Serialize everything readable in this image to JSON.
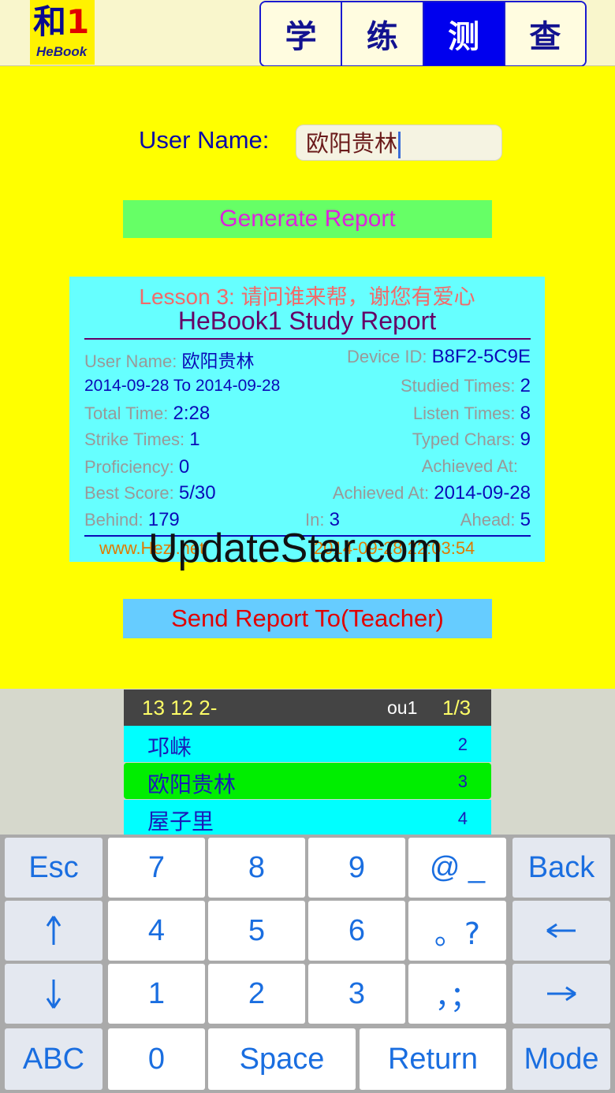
{
  "logo": {
    "glyph": "和",
    "digit": "1",
    "name": "HeBook"
  },
  "tabs": [
    {
      "label": "学",
      "active": false
    },
    {
      "label": "练",
      "active": false
    },
    {
      "label": "测",
      "active": true
    },
    {
      "label": "查",
      "active": false
    }
  ],
  "form": {
    "user_label": "User Name:",
    "user_value": "欧阳贵林",
    "generate_label": "Generate Report",
    "send_label": "Send Report To(Teacher)"
  },
  "report": {
    "lesson_prefix": "Lesson 3: ",
    "lesson_title": "请问谁来帮，谢您有爱心",
    "title": "HeBook1 Study Report",
    "user_label": "User Name: ",
    "user_value": "欧阳贵林",
    "device_label": "Device ID: ",
    "device_value": "B8F2-5C9E",
    "date_range": "2014-09-28 To 2014-09-28",
    "studied_label": "Studied Times: ",
    "studied_value": "2",
    "total_time_label": "Total Time: ",
    "total_time_value": "2:28",
    "listen_label": "Listen Times: ",
    "listen_value": "8",
    "strike_label": "Strike Times: ",
    "strike_value": "1",
    "typed_label": "Typed Chars: ",
    "typed_value": "9",
    "proficiency_label": "Proficiency: ",
    "proficiency_value": "0",
    "achieved_label_1": "Achieved At:",
    "best_label": "Best Score: ",
    "best_value": "5/30",
    "achieved_label_2": "Achieved At: ",
    "achieved_value_2": "2014-09-28",
    "behind_label": "Behind: ",
    "behind_value": "179",
    "in_label": "In: ",
    "in_value": "3",
    "ahead_label": "Ahead: ",
    "ahead_value": "5",
    "footer_url": "www.Hezi.net",
    "footer_time": "2014-09-28 22:03:54"
  },
  "watermark": "UpdateStar.com",
  "candidates": {
    "code": "13 12 2-",
    "pinyin": "ou1",
    "page": "1/3",
    "items": [
      {
        "word": "邛崃",
        "num": "2",
        "selected": false
      },
      {
        "word": "欧阳贵林",
        "num": "3",
        "selected": true
      },
      {
        "word": "屋子里",
        "num": "4",
        "selected": false
      }
    ]
  },
  "keyboard": {
    "esc": "Esc",
    "back": "Back",
    "abc": "ABC",
    "space": "Space",
    "return": "Return",
    "mode": "Mode",
    "k7": "7",
    "k8": "8",
    "k9": "9",
    "k4": "4",
    "k5": "5",
    "k6": "6",
    "k1": "1",
    "k2": "2",
    "k3": "3",
    "k0": "0",
    "at": "@  _",
    "punct1": "。?",
    "punct2": "，；",
    "icons": {
      "up": "up-arrow-icon",
      "down": "down-arrow-icon",
      "left": "left-arrow-icon",
      "right": "right-arrow-icon"
    }
  },
  "colors": {
    "main_bg": "#ffff00",
    "report_bg": "#66ffff",
    "tab_active": "#0000ee",
    "generate_bg": "#66ff66",
    "send_bg": "#66ccff",
    "key_text": "#1a6ee0"
  }
}
